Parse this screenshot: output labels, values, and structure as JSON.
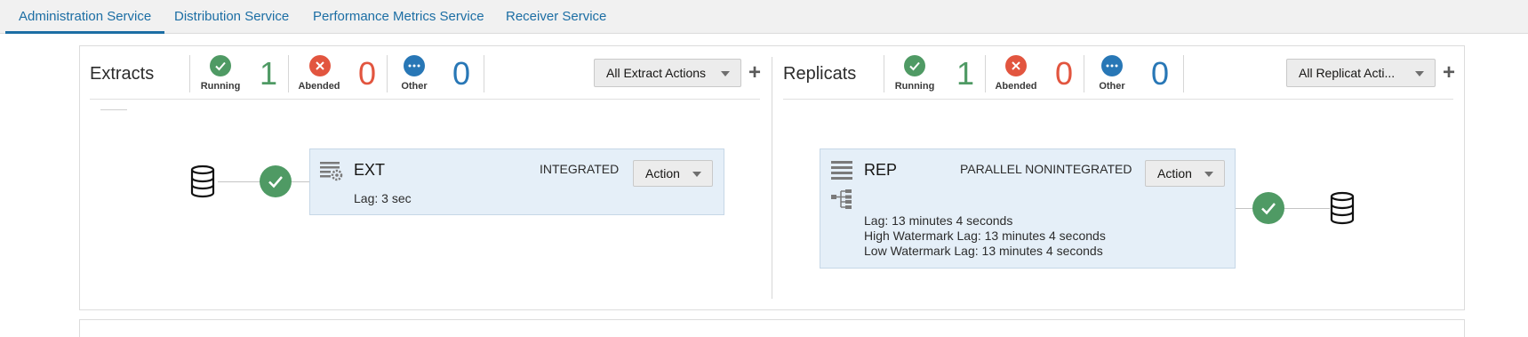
{
  "tabs": [
    {
      "label": "Administration Service"
    },
    {
      "label": "Distribution Service"
    },
    {
      "label": "Performance Metrics Service"
    },
    {
      "label": "Receiver Service"
    }
  ],
  "colors": {
    "accent": "#1c6ea4",
    "running": "#4f9a64",
    "abended": "#e2553f",
    "other": "#2877b6",
    "card_bg": "#e5eff8"
  },
  "extracts": {
    "title": "Extracts",
    "running_label": "Running",
    "running_count": "1",
    "abended_label": "Abended",
    "abended_count": "0",
    "other_label": "Other",
    "other_count": "0",
    "actions_label": "All Extract Actions",
    "add_icon": "plus-icon",
    "card": {
      "name": "EXT",
      "type": "INTEGRATED",
      "action_label": "Action",
      "lag": "Lag: 3 sec",
      "status": "running"
    }
  },
  "replicats": {
    "title": "Replicats",
    "running_label": "Running",
    "running_count": "1",
    "abended_label": "Abended",
    "abended_count": "0",
    "other_label": "Other",
    "other_count": "0",
    "actions_label": "All Replicat Acti...",
    "add_icon": "plus-icon",
    "card": {
      "name": "REP",
      "type": "PARALLEL NONINTEGRATED",
      "action_label": "Action",
      "lag": "Lag: 13 minutes 4 seconds",
      "high_watermark_lag": "High Watermark Lag: 13 minutes 4 seconds",
      "low_watermark_lag": "Low Watermark Lag: 13 minutes 4 seconds",
      "status": "running"
    }
  }
}
